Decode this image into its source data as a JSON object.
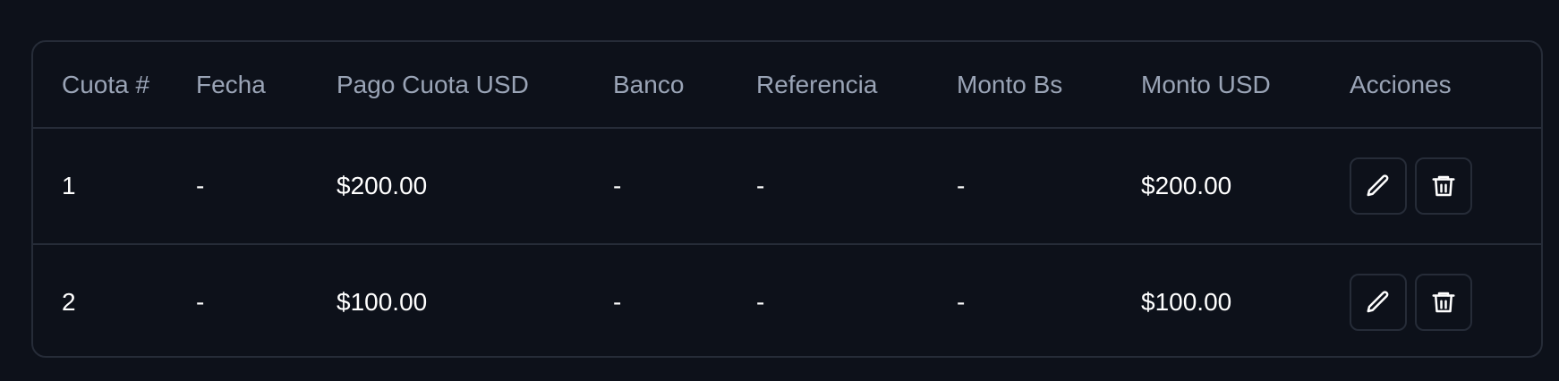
{
  "table": {
    "headers": [
      "Cuota #",
      "Fecha",
      "Pago Cuota USD",
      "Banco",
      "Referencia",
      "Monto Bs",
      "Monto USD",
      "Acciones"
    ],
    "rows": [
      {
        "cuota": "1",
        "fecha": "-",
        "pago_cuota_usd": "$200.00",
        "banco": "-",
        "referencia": "-",
        "monto_bs": "-",
        "monto_usd": "$200.00"
      },
      {
        "cuota": "2",
        "fecha": "-",
        "pago_cuota_usd": "$100.00",
        "banco": "-",
        "referencia": "-",
        "monto_bs": "-",
        "monto_usd": "$100.00"
      }
    ],
    "actions": {
      "edit_icon": "pencil-icon",
      "delete_icon": "trash-icon"
    }
  },
  "colors": {
    "background": "#0d111a",
    "border": "#262c38",
    "header_text": "#9aa4b6",
    "cell_text": "#ffffff"
  }
}
